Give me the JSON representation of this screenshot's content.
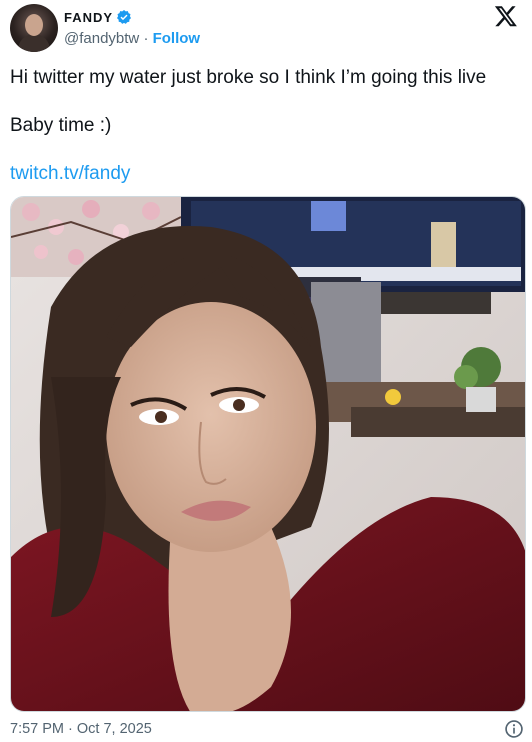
{
  "author": {
    "display_name": "FANDY",
    "handle": "@fandybtw",
    "separator": "·",
    "follow_label": "Follow",
    "verified_icon": "verified-badge-icon",
    "avatar_icon": "avatar"
  },
  "tweet": {
    "line1": "Hi twitter my water just broke so I think I’m going this live",
    "line2": "Baby time :)",
    "link": "twitch.tv/fandy"
  },
  "media": {
    "icon": "photo-selfie"
  },
  "meta": {
    "timestamp": "7:57 PM · Oct 7, 2025"
  },
  "colors": {
    "accent": "#1d9bf0",
    "muted": "#536471",
    "text": "#0f1419"
  }
}
